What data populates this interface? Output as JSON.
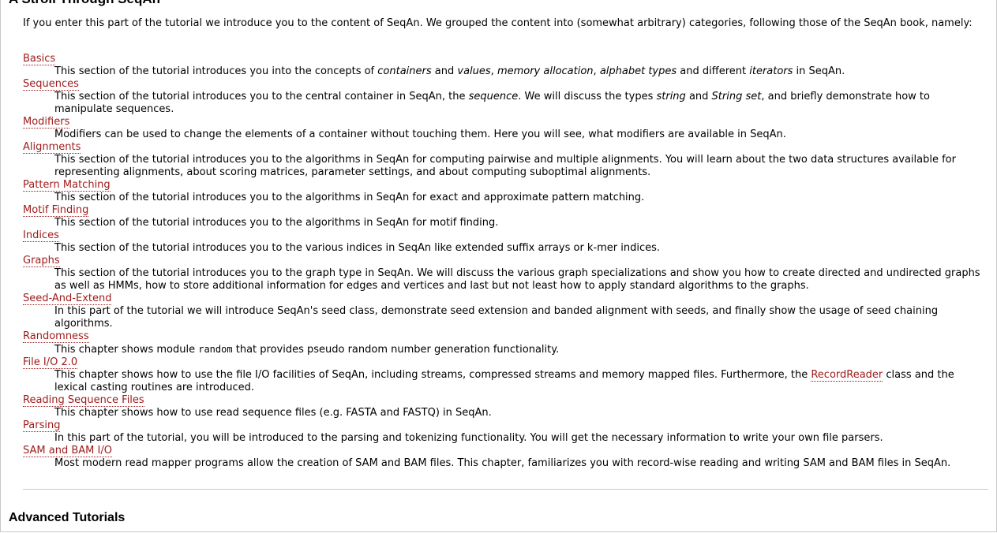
{
  "section_title": "A Stroll Through SeqAn",
  "intro": "If you enter this part of the tutorial we introduce you to the content of SeqAn. We grouped the content into (somewhat arbitrary) categories, following those of the SeqAn book, namely:",
  "topics": [
    {
      "title": "Basics",
      "desc": [
        {
          "t": "This section of the tutorial introduces you into the concepts of "
        },
        {
          "t": "containers",
          "i": true
        },
        {
          "t": " and "
        },
        {
          "t": "values",
          "i": true
        },
        {
          "t": ", "
        },
        {
          "t": "memory allocation",
          "i": true
        },
        {
          "t": ", "
        },
        {
          "t": "alphabet types",
          "i": true
        },
        {
          "t": " and different "
        },
        {
          "t": "iterators",
          "i": true
        },
        {
          "t": " in SeqAn."
        }
      ]
    },
    {
      "title": "Sequences",
      "desc": [
        {
          "t": "This section of the tutorial introduces you to the central container in SeqAn, the "
        },
        {
          "t": "sequence",
          "i": true
        },
        {
          "t": ". We will discuss the types "
        },
        {
          "t": "string",
          "i": true
        },
        {
          "t": " and "
        },
        {
          "t": "String set",
          "i": true
        },
        {
          "t": ", and briefly demonstrate how to manipulate sequences."
        }
      ]
    },
    {
      "title": "Modifiers",
      "desc": [
        {
          "t": "Modifiers can be used to change the elements of a container without touching them. Here you will see, what modifiers are available in SeqAn."
        }
      ]
    },
    {
      "title": "Alignments",
      "desc": [
        {
          "t": "This section of the tutorial introduces you to the algorithms in SeqAn for computing pairwise and multiple alignments. You will learn about the two data structures available for representing alignments, about scoring matrices, parameter settings, and about computing suboptimal alignments."
        }
      ]
    },
    {
      "title": "Pattern Matching",
      "desc": [
        {
          "t": "This section of the tutorial introduces you to the algorithms in SeqAn for exact and approximate pattern matching."
        }
      ]
    },
    {
      "title": "Motif Finding",
      "desc": [
        {
          "t": "This section of the tutorial introduces you to the algorithms in SeqAn for motif finding."
        }
      ]
    },
    {
      "title": "Indices",
      "desc": [
        {
          "t": "This section of the tutorial introduces you to the various indices in SeqAn like extended suffix arrays or k-mer indices."
        }
      ]
    },
    {
      "title": "Graphs",
      "desc": [
        {
          "t": "This section of the tutorial introduces you to the graph type in SeqAn. We will discuss the various graph specializations and show you how to create directed and undirected graphs as well as HMMs, how to store additional information for edges and vertices and last but not least how to apply standard algorithms to the graphs."
        }
      ]
    },
    {
      "title": "Seed-And-Extend",
      "desc": [
        {
          "t": "In this part of the tutorial we will introduce SeqAn's seed class, demonstrate seed extension and banded alignment with seeds, and finally show the usage of seed chaining algorithms."
        }
      ]
    },
    {
      "title": "Randomness",
      "desc": [
        {
          "t": "This chapter shows module "
        },
        {
          "t": "random",
          "m": true
        },
        {
          "t": " that provides pseudo random number generation functionality."
        }
      ]
    },
    {
      "title": "File I/O 2.0",
      "desc": [
        {
          "t": "This chapter shows how to use the file I/O facilities of SeqAn, including streams, compressed streams and memory mapped files. Furthermore, the "
        },
        {
          "t": "RecordReader",
          "link": true
        },
        {
          "t": " class and the lexical casting routines are introduced."
        }
      ]
    },
    {
      "title": "Reading Sequence Files",
      "desc": [
        {
          "t": "This chapter shows how to use read sequence files (e.g. FASTA and FASTQ) in SeqAn."
        }
      ]
    },
    {
      "title": "Parsing",
      "desc": [
        {
          "t": "In this part of the tutorial, you will be introduced to the parsing and tokenizing functionality. You will get the necessary information to write your own file parsers."
        }
      ]
    },
    {
      "title": "SAM and BAM I/O",
      "desc": [
        {
          "t": "Most modern read mapper programs allow the creation of SAM and BAM files. This chapter, familiarizes you with record-wise reading and writing SAM and BAM files in SeqAn."
        }
      ]
    }
  ],
  "advanced_title": "Advanced Tutorials",
  "colors": {
    "link": "#9e1a1a",
    "divider": "#cfcbb7"
  }
}
